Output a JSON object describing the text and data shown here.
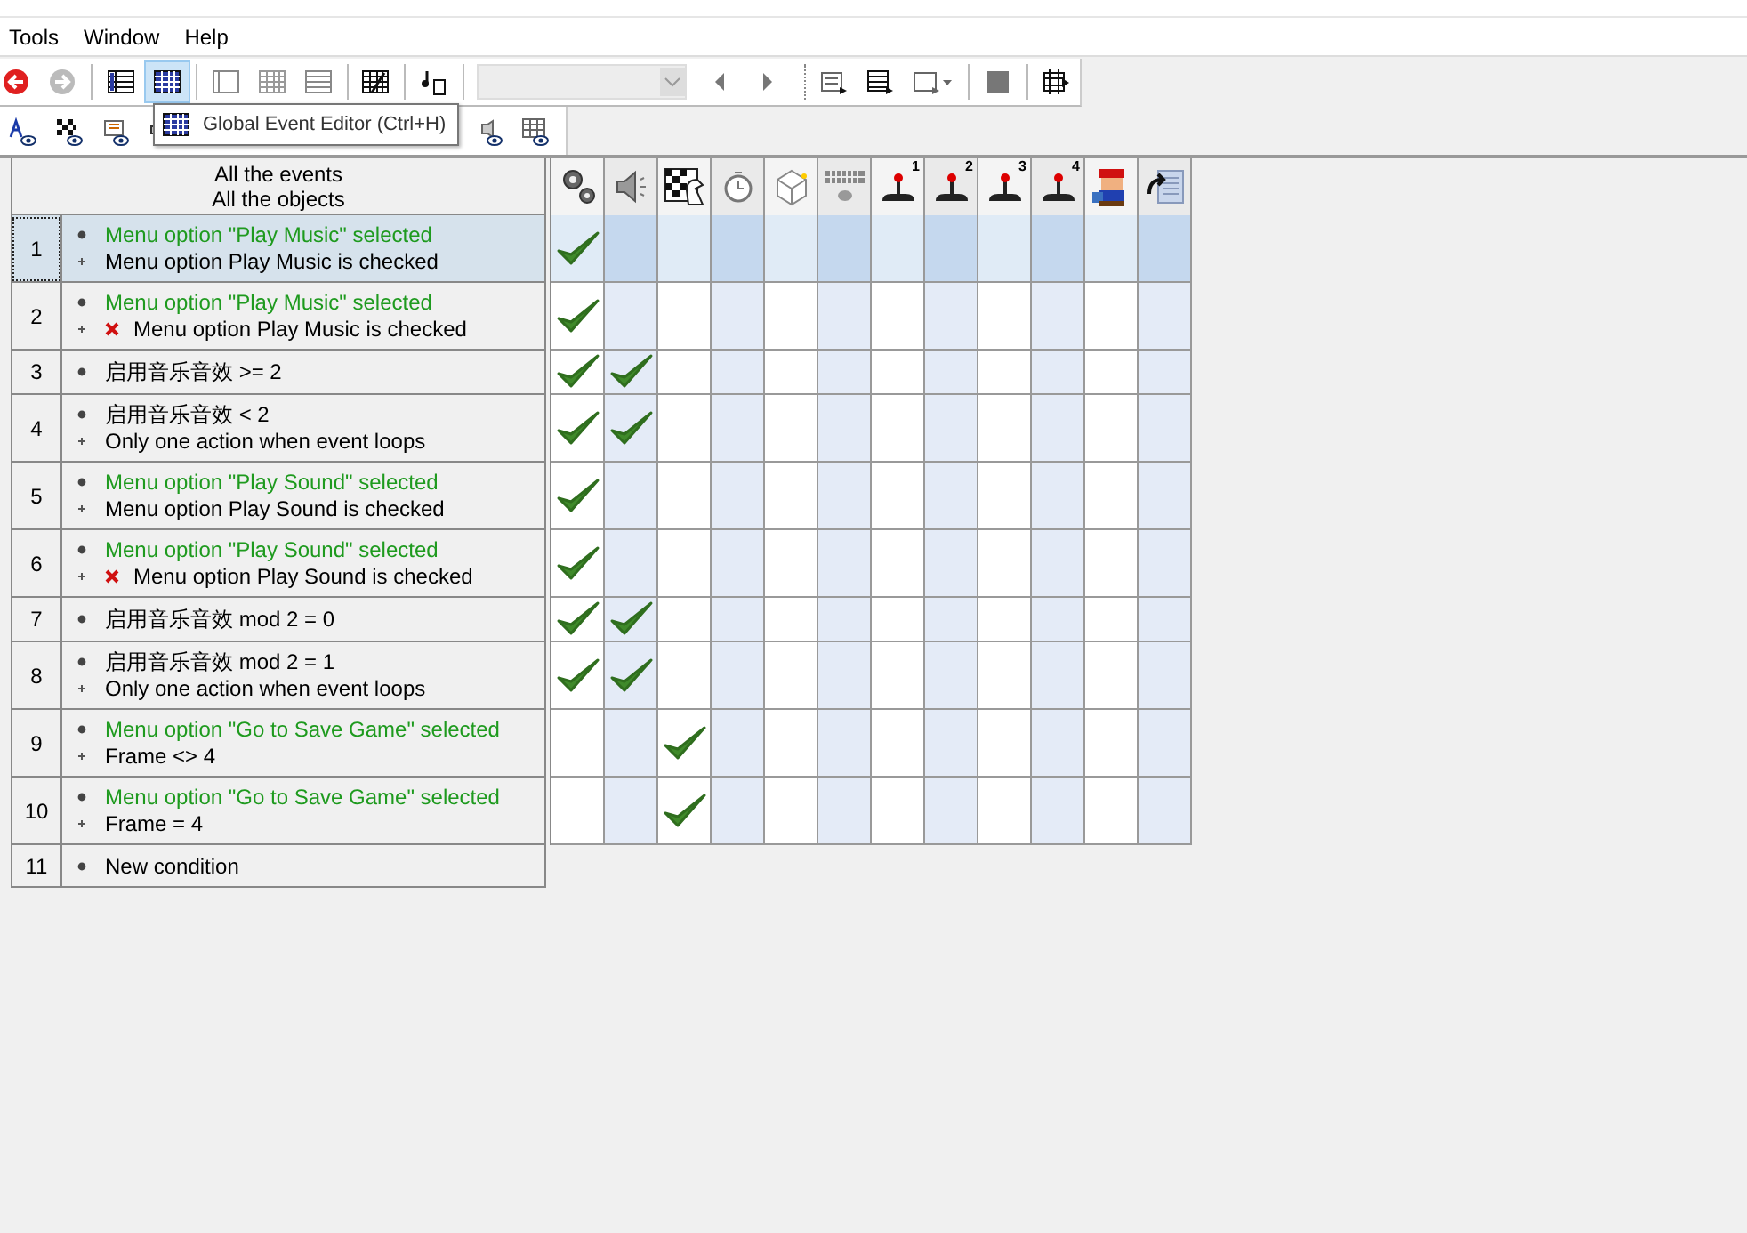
{
  "menu": [
    {
      "label": "Tools"
    },
    {
      "label": "Window"
    },
    {
      "label": "Help"
    }
  ],
  "tooltip": {
    "text": "Global Event Editor (Ctrl+H)"
  },
  "toolbar": {
    "global_editor_selected": true
  },
  "header": {
    "line_1": "All the events",
    "line_2": "All the objects"
  },
  "columns": [
    {
      "kind": "gears"
    },
    {
      "kind": "speaker"
    },
    {
      "kind": "chess"
    },
    {
      "kind": "timer"
    },
    {
      "kind": "box"
    },
    {
      "kind": "keyboard"
    },
    {
      "kind": "joystick",
      "label": "1"
    },
    {
      "kind": "joystick",
      "label": "2"
    },
    {
      "kind": "joystick",
      "label": "3"
    },
    {
      "kind": "joystick",
      "label": "4"
    },
    {
      "kind": "sprite"
    },
    {
      "kind": "storyboard"
    }
  ],
  "events": [
    {
      "number": "1",
      "selected": true,
      "conditions": [
        {
          "kind": "event",
          "text": "Menu option \"Play Music\" selected",
          "color": "#1e9a1e",
          "negated": false
        },
        {
          "kind": "condition",
          "text": "Menu option Play Music is checked",
          "color": "#000000",
          "negated": false
        }
      ],
      "checks": [
        true,
        false,
        false,
        false,
        false,
        false,
        false,
        false,
        false,
        false,
        false,
        false
      ]
    },
    {
      "number": "2",
      "selected": false,
      "conditions": [
        {
          "kind": "event",
          "text": "Menu option \"Play Music\" selected",
          "color": "#1e9a1e",
          "negated": false
        },
        {
          "kind": "condition",
          "text": "Menu option Play Music is checked",
          "color": "#000000",
          "negated": true
        }
      ],
      "checks": [
        true,
        false,
        false,
        false,
        false,
        false,
        false,
        false,
        false,
        false,
        false,
        false
      ]
    },
    {
      "number": "3",
      "selected": false,
      "conditions": [
        {
          "kind": "event",
          "text": "启用音乐音效 >= 2",
          "color": "#000000",
          "negated": false
        }
      ],
      "checks": [
        true,
        true,
        false,
        false,
        false,
        false,
        false,
        false,
        false,
        false,
        false,
        false
      ]
    },
    {
      "number": "4",
      "selected": false,
      "conditions": [
        {
          "kind": "event",
          "text": "启用音乐音效 < 2",
          "color": "#000000",
          "negated": false
        },
        {
          "kind": "condition",
          "text": "Only one action when event loops",
          "color": "#000000",
          "negated": false
        }
      ],
      "checks": [
        true,
        true,
        false,
        false,
        false,
        false,
        false,
        false,
        false,
        false,
        false,
        false
      ]
    },
    {
      "number": "5",
      "selected": false,
      "conditions": [
        {
          "kind": "event",
          "text": "Menu option \"Play Sound\" selected",
          "color": "#1e9a1e",
          "negated": false
        },
        {
          "kind": "condition",
          "text": "Menu option Play Sound is checked",
          "color": "#000000",
          "negated": false
        }
      ],
      "checks": [
        true,
        false,
        false,
        false,
        false,
        false,
        false,
        false,
        false,
        false,
        false,
        false
      ]
    },
    {
      "number": "6",
      "selected": false,
      "conditions": [
        {
          "kind": "event",
          "text": "Menu option \"Play Sound\" selected",
          "color": "#1e9a1e",
          "negated": false
        },
        {
          "kind": "condition",
          "text": "Menu option Play Sound is checked",
          "color": "#000000",
          "negated": true
        }
      ],
      "checks": [
        true,
        false,
        false,
        false,
        false,
        false,
        false,
        false,
        false,
        false,
        false,
        false
      ]
    },
    {
      "number": "7",
      "selected": false,
      "conditions": [
        {
          "kind": "event",
          "text": "启用音乐音效 mod 2 = 0",
          "color": "#000000",
          "negated": false
        }
      ],
      "checks": [
        true,
        true,
        false,
        false,
        false,
        false,
        false,
        false,
        false,
        false,
        false,
        false
      ]
    },
    {
      "number": "8",
      "selected": false,
      "conditions": [
        {
          "kind": "event",
          "text": "启用音乐音效 mod 2 = 1",
          "color": "#000000",
          "negated": false
        },
        {
          "kind": "condition",
          "text": "Only one action when event loops",
          "color": "#000000",
          "negated": false
        }
      ],
      "checks": [
        true,
        true,
        false,
        false,
        false,
        false,
        false,
        false,
        false,
        false,
        false,
        false
      ]
    },
    {
      "number": "9",
      "selected": false,
      "conditions": [
        {
          "kind": "event",
          "text": "Menu option \"Go to Save Game\" selected",
          "color": "#1e9a1e",
          "negated": false
        },
        {
          "kind": "condition",
          "text": "Frame <> 4",
          "color": "#000000",
          "negated": false
        }
      ],
      "checks": [
        false,
        false,
        true,
        false,
        false,
        false,
        false,
        false,
        false,
        false,
        false,
        false
      ]
    },
    {
      "number": "10",
      "selected": false,
      "conditions": [
        {
          "kind": "event",
          "text": "Menu option \"Go to Save Game\" selected",
          "color": "#1e9a1e",
          "negated": false
        },
        {
          "kind": "condition",
          "text": "Frame = 4",
          "color": "#000000",
          "negated": false
        }
      ],
      "checks": [
        false,
        false,
        true,
        false,
        false,
        false,
        false,
        false,
        false,
        false,
        false,
        false
      ]
    },
    {
      "number": "11",
      "selected": false,
      "conditions": [
        {
          "kind": "event",
          "text": "New condition",
          "color": "#000000",
          "negated": false
        }
      ]
    }
  ]
}
